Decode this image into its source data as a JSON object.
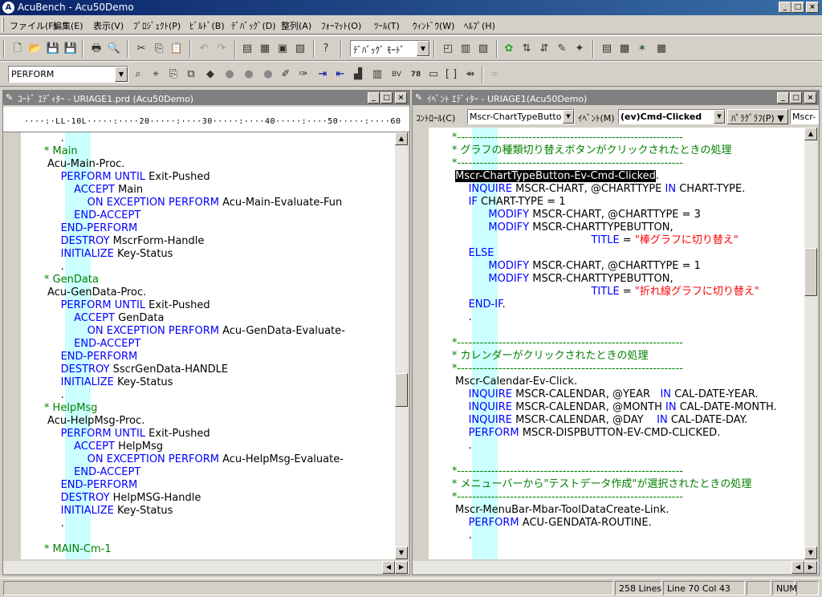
{
  "window": {
    "app_icon": "A",
    "title": "AcuBench - Acu50Demo",
    "minimize_glyph": "_",
    "maximize_glyph": "□",
    "close_glyph": "×"
  },
  "menu": [
    "ファイル(F)",
    "編集(E)",
    "表示(V)",
    "ﾌﾟﾛｼﾞｪｸﾄ(P)",
    "ﾋﾞﾙﾄﾞ(B)",
    "ﾃﾞﾊﾞｯｸﾞ(D)",
    "整列(A)",
    "ﾌｫｰﾏｯﾄ(O)",
    "ﾂｰﾙ(T)",
    "ｳｨﾝﾄﾞｳ(W)",
    "ﾍﾙﾌﾟ(H)"
  ],
  "toolbar": {
    "mode_select": "ﾃﾞﾊﾞｯｸﾞ ﾓｰﾄﾞ",
    "keyword_select": "PERFORM"
  },
  "code_editor": {
    "title": "ｺｰﾄﾞ ｴﾃﾞｨﾀｰ - URIAGE1.prd (Acu50Demo)",
    "ruler": "····:·LL·10L·····:····20·····:····30·····:····40·····:····50·····:····60",
    "lines": [
      [
        {
          "t": "            ."
        }
      ],
      [
        {
          "t": "       * Main",
          "c": "cm"
        }
      ],
      [
        {
          "t": "        Acu-Main-Proc."
        }
      ],
      [
        {
          "t": "            "
        },
        {
          "t": "PERFORM UNTIL",
          "c": "kw"
        },
        {
          "t": " Exit-Pushed"
        }
      ],
      [
        {
          "t": "                "
        },
        {
          "t": "ACCEPT",
          "c": "kw"
        },
        {
          "t": " Main"
        }
      ],
      [
        {
          "t": "                    "
        },
        {
          "t": "ON EXCEPTION PERFORM",
          "c": "kw"
        },
        {
          "t": " Acu-Main-Evaluate-Fun"
        }
      ],
      [
        {
          "t": "                "
        },
        {
          "t": "END-ACCEPT",
          "c": "kw"
        }
      ],
      [
        {
          "t": "            "
        },
        {
          "t": "END-PERFORM",
          "c": "kw"
        }
      ],
      [
        {
          "t": "            "
        },
        {
          "t": "DESTROY",
          "c": "kw"
        },
        {
          "t": " MscrForm-Handle"
        }
      ],
      [
        {
          "t": "            "
        },
        {
          "t": "INITIALIZE",
          "c": "kw"
        },
        {
          "t": " Key-Status"
        }
      ],
      [
        {
          "t": "            ."
        }
      ],
      [
        {
          "t": "       * GenData",
          "c": "cm"
        }
      ],
      [
        {
          "t": "        Acu-GenData-Proc."
        }
      ],
      [
        {
          "t": "            "
        },
        {
          "t": "PERFORM UNTIL",
          "c": "kw"
        },
        {
          "t": " Exit-Pushed"
        }
      ],
      [
        {
          "t": "                "
        },
        {
          "t": "ACCEPT",
          "c": "kw"
        },
        {
          "t": " GenData"
        }
      ],
      [
        {
          "t": "                    "
        },
        {
          "t": "ON EXCEPTION PERFORM",
          "c": "kw"
        },
        {
          "t": " Acu-GenData-Evaluate-"
        }
      ],
      [
        {
          "t": "                "
        },
        {
          "t": "END-ACCEPT",
          "c": "kw"
        }
      ],
      [
        {
          "t": "            "
        },
        {
          "t": "END-PERFORM",
          "c": "kw"
        }
      ],
      [
        {
          "t": "            "
        },
        {
          "t": "DESTROY",
          "c": "kw"
        },
        {
          "t": " SscrGenData-HANDLE"
        }
      ],
      [
        {
          "t": "            "
        },
        {
          "t": "INITIALIZE",
          "c": "kw"
        },
        {
          "t": " Key-Status"
        }
      ],
      [
        {
          "t": "            ."
        }
      ],
      [
        {
          "t": "       * HelpMsg",
          "c": "cm"
        }
      ],
      [
        {
          "t": "        Acu-HelpMsg-Proc."
        }
      ],
      [
        {
          "t": "            "
        },
        {
          "t": "PERFORM UNTIL",
          "c": "kw"
        },
        {
          "t": " Exit-Pushed"
        }
      ],
      [
        {
          "t": "                "
        },
        {
          "t": "ACCEPT",
          "c": "kw"
        },
        {
          "t": " HelpMsg"
        }
      ],
      [
        {
          "t": "                    "
        },
        {
          "t": "ON EXCEPTION PERFORM",
          "c": "kw"
        },
        {
          "t": " Acu-HelpMsg-Evaluate-"
        }
      ],
      [
        {
          "t": "                "
        },
        {
          "t": "END-ACCEPT",
          "c": "kw"
        }
      ],
      [
        {
          "t": "            "
        },
        {
          "t": "END-PERFORM",
          "c": "kw"
        }
      ],
      [
        {
          "t": "            "
        },
        {
          "t": "DESTROY",
          "c": "kw"
        },
        {
          "t": " HelpMSG-Handle"
        }
      ],
      [
        {
          "t": "            "
        },
        {
          "t": "INITIALIZE",
          "c": "kw"
        },
        {
          "t": " Key-Status"
        }
      ],
      [
        {
          "t": "            ."
        }
      ],
      [
        {
          "t": ""
        }
      ],
      [
        {
          "t": "       * MAIN-Cm-1",
          "c": "cm"
        }
      ]
    ]
  },
  "event_editor": {
    "title": "ｲﾍﾞﾝﾄ ｴﾃﾞｨﾀｰ - URIAGE1(Acu50Demo)",
    "control_label": "ｺﾝﾄﾛｰﾙ(C)",
    "control_value": "Mscr-ChartTypeButto",
    "event_label": "ｲﾍﾞﾝﾄ(M)",
    "event_value": "(ev)Cmd-Clicked",
    "paragraph_label": "ﾊﾟﾗｸﾞﾗﾌ(P) ▼",
    "paragraph_value": "Mscr-",
    "lines": [
      [
        {
          "t": "       *------------------------------------------------------------",
          "c": "cm"
        }
      ],
      [
        {
          "t": "       * グラフの種類切り替えボタンがクリックされたときの処理",
          "c": "cm"
        }
      ],
      [
        {
          "t": "       *------------------------------------------------------------",
          "c": "cm"
        }
      ],
      [
        {
          "t": "        "
        },
        {
          "t": "Mscr-ChartTypeButton-Ev-Cmd-Clicked",
          "c": "sel"
        },
        {
          "t": "."
        }
      ],
      [
        {
          "t": "            "
        },
        {
          "t": "INQUIRE",
          "c": "kw"
        },
        {
          "t": " MSCR-CHART, @CHARTTYPE "
        },
        {
          "t": "IN",
          "c": "kw"
        },
        {
          "t": " CHART-TYPE."
        }
      ],
      [
        {
          "t": "            "
        },
        {
          "t": "IF",
          "c": "kw"
        },
        {
          "t": " CHART-TYPE = 1"
        }
      ],
      [
        {
          "t": "                  "
        },
        {
          "t": "MODIFY",
          "c": "kw"
        },
        {
          "t": " MSCR-CHART, @CHARTTYPE = 3"
        }
      ],
      [
        {
          "t": "                  "
        },
        {
          "t": "MODIFY",
          "c": "kw"
        },
        {
          "t": " MSCR-CHARTTYPEBUTTON,"
        }
      ],
      [
        {
          "t": "                                                 "
        },
        {
          "t": "TITLE",
          "c": "kw"
        },
        {
          "t": " = "
        },
        {
          "t": "\"棒グラフに切り替え\"",
          "c": "st"
        }
      ],
      [
        {
          "t": "            "
        },
        {
          "t": "ELSE",
          "c": "kw"
        }
      ],
      [
        {
          "t": "                  "
        },
        {
          "t": "MODIFY",
          "c": "kw"
        },
        {
          "t": " MSCR-CHART, @CHARTTYPE = 1"
        }
      ],
      [
        {
          "t": "                  "
        },
        {
          "t": "MODIFY",
          "c": "kw"
        },
        {
          "t": " MSCR-CHARTTYPEBUTTON,"
        }
      ],
      [
        {
          "t": "                                                 "
        },
        {
          "t": "TITLE",
          "c": "kw"
        },
        {
          "t": " = "
        },
        {
          "t": "\"折れ線グラフに切り替え\"",
          "c": "st"
        }
      ],
      [
        {
          "t": "            "
        },
        {
          "t": "END-IF",
          "c": "kw"
        },
        {
          "t": "."
        }
      ],
      [
        {
          "t": "            ."
        }
      ],
      [
        {
          "t": ""
        }
      ],
      [
        {
          "t": "       *------------------------------------------------------------",
          "c": "cm"
        }
      ],
      [
        {
          "t": "       * カレンダーがクリックされたときの処理",
          "c": "cm"
        }
      ],
      [
        {
          "t": "       *------------------------------------------------------------",
          "c": "cm"
        }
      ],
      [
        {
          "t": "        Mscr-Calendar-Ev-Click."
        }
      ],
      [
        {
          "t": "            "
        },
        {
          "t": "INQUIRE",
          "c": "kw"
        },
        {
          "t": " MSCR-CALENDAR, @YEAR   "
        },
        {
          "t": "IN",
          "c": "kw"
        },
        {
          "t": " CAL-DATE-YEAR."
        }
      ],
      [
        {
          "t": "            "
        },
        {
          "t": "INQUIRE",
          "c": "kw"
        },
        {
          "t": " MSCR-CALENDAR, @MONTH "
        },
        {
          "t": "IN",
          "c": "kw"
        },
        {
          "t": " CAL-DATE-MONTH."
        }
      ],
      [
        {
          "t": "            "
        },
        {
          "t": "INQUIRE",
          "c": "kw"
        },
        {
          "t": " MSCR-CALENDAR, @DAY    "
        },
        {
          "t": "IN",
          "c": "kw"
        },
        {
          "t": " CAL-DATE-DAY."
        }
      ],
      [
        {
          "t": "            "
        },
        {
          "t": "PERFORM",
          "c": "kw"
        },
        {
          "t": " MSCR-DISPBUTTON-EV-CMD-CLICKED."
        }
      ],
      [
        {
          "t": "            ."
        }
      ],
      [
        {
          "t": ""
        }
      ],
      [
        {
          "t": "       *------------------------------------------------------------",
          "c": "cm"
        }
      ],
      [
        {
          "t": "       * メニューバーから\"テストデータ作成\"が選択されたときの処理",
          "c": "cm"
        }
      ],
      [
        {
          "t": "       *------------------------------------------------------------",
          "c": "cm"
        }
      ],
      [
        {
          "t": "        Mscr-MenuBar-Mbar-ToolDataCreate-Link."
        }
      ],
      [
        {
          "t": "            "
        },
        {
          "t": "PERFORM",
          "c": "kw"
        },
        {
          "t": " ACU-GENDATA-ROUTINE."
        }
      ],
      [
        {
          "t": "            ."
        }
      ]
    ]
  },
  "status": {
    "lines": "258 Lines",
    "position": "Line 70 Col 43",
    "num": "NUM"
  }
}
